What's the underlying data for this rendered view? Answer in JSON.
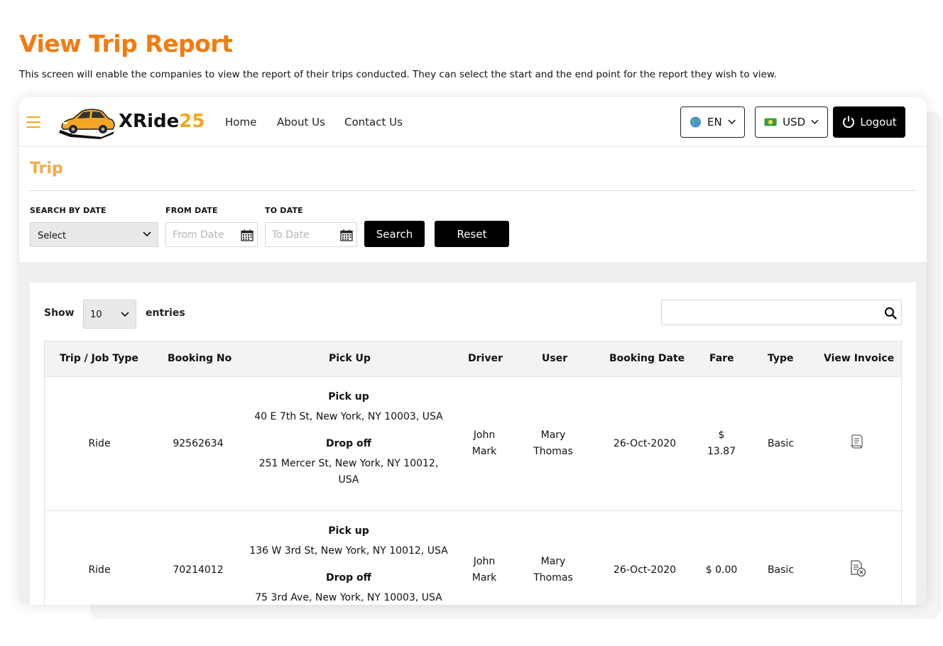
{
  "page": {
    "title": "View Trip Report",
    "description": "This screen will enable the companies to view the report of their trips conducted. They can select the start and the end point for the report they wish to view."
  },
  "navbar": {
    "brand_main": "XRide",
    "brand_num": "25",
    "links": [
      "Home",
      "About Us",
      "Contact Us"
    ],
    "language": "EN",
    "currency": "USD",
    "logout_label": "Logout"
  },
  "trip": {
    "title": "Trip",
    "filters": {
      "search_by_date_label": "SEARCH BY DATE",
      "search_by_date_value": "Select",
      "from_label": "FROM DATE",
      "from_placeholder": "From Date",
      "to_label": "TO DATE",
      "to_placeholder": "To Date",
      "search_button": "Search",
      "reset_button": "Reset"
    }
  },
  "table_controls": {
    "show_label": "Show",
    "entries_value": "10",
    "entries_label": "entries",
    "search_value": ""
  },
  "table": {
    "columns": [
      "Trip / Job Type",
      "Booking No",
      "Pick Up",
      "Driver",
      "User",
      "Booking Date",
      "Fare",
      "Type",
      "View Invoice"
    ],
    "rows": [
      {
        "job_type": "Ride",
        "booking_no": "92562634",
        "pickup_heading": "Pick up",
        "pickup_address": "40 E 7th St, New York, NY 10003, USA",
        "dropoff_heading": "Drop off",
        "dropoff_line1": "251 Mercer St, New York, NY 10012,",
        "dropoff_line2": "USA",
        "driver_first": "John",
        "driver_last": "Mark",
        "user_first": "Mary",
        "user_last": "Thomas",
        "booking_date": "26-Oct-2020",
        "fare_symbol": "$",
        "fare_amount": "13.87",
        "type": "Basic",
        "invoice_icon": "invoice-icon"
      },
      {
        "job_type": "Ride",
        "booking_no": "70214012",
        "pickup_heading": "Pick up",
        "pickup_address": "136 W 3rd St, New York, NY 10012, USA",
        "dropoff_heading": "Drop off",
        "dropoff_line1": "75 3rd Ave, New York, NY 10003, USA",
        "driver_first": "John",
        "driver_last": "Mark",
        "user_first": "Mary",
        "user_last": "Thomas",
        "booking_date": "26-Oct-2020",
        "fare": "$ 0.00",
        "type": "Basic",
        "invoice_icon": "invoice-cancelled-icon"
      }
    ]
  },
  "colors": {
    "title_orange": "#f47b0f",
    "section_orange": "#f5a947",
    "brand_orange": "#f5a623",
    "button_black": "#000000"
  }
}
